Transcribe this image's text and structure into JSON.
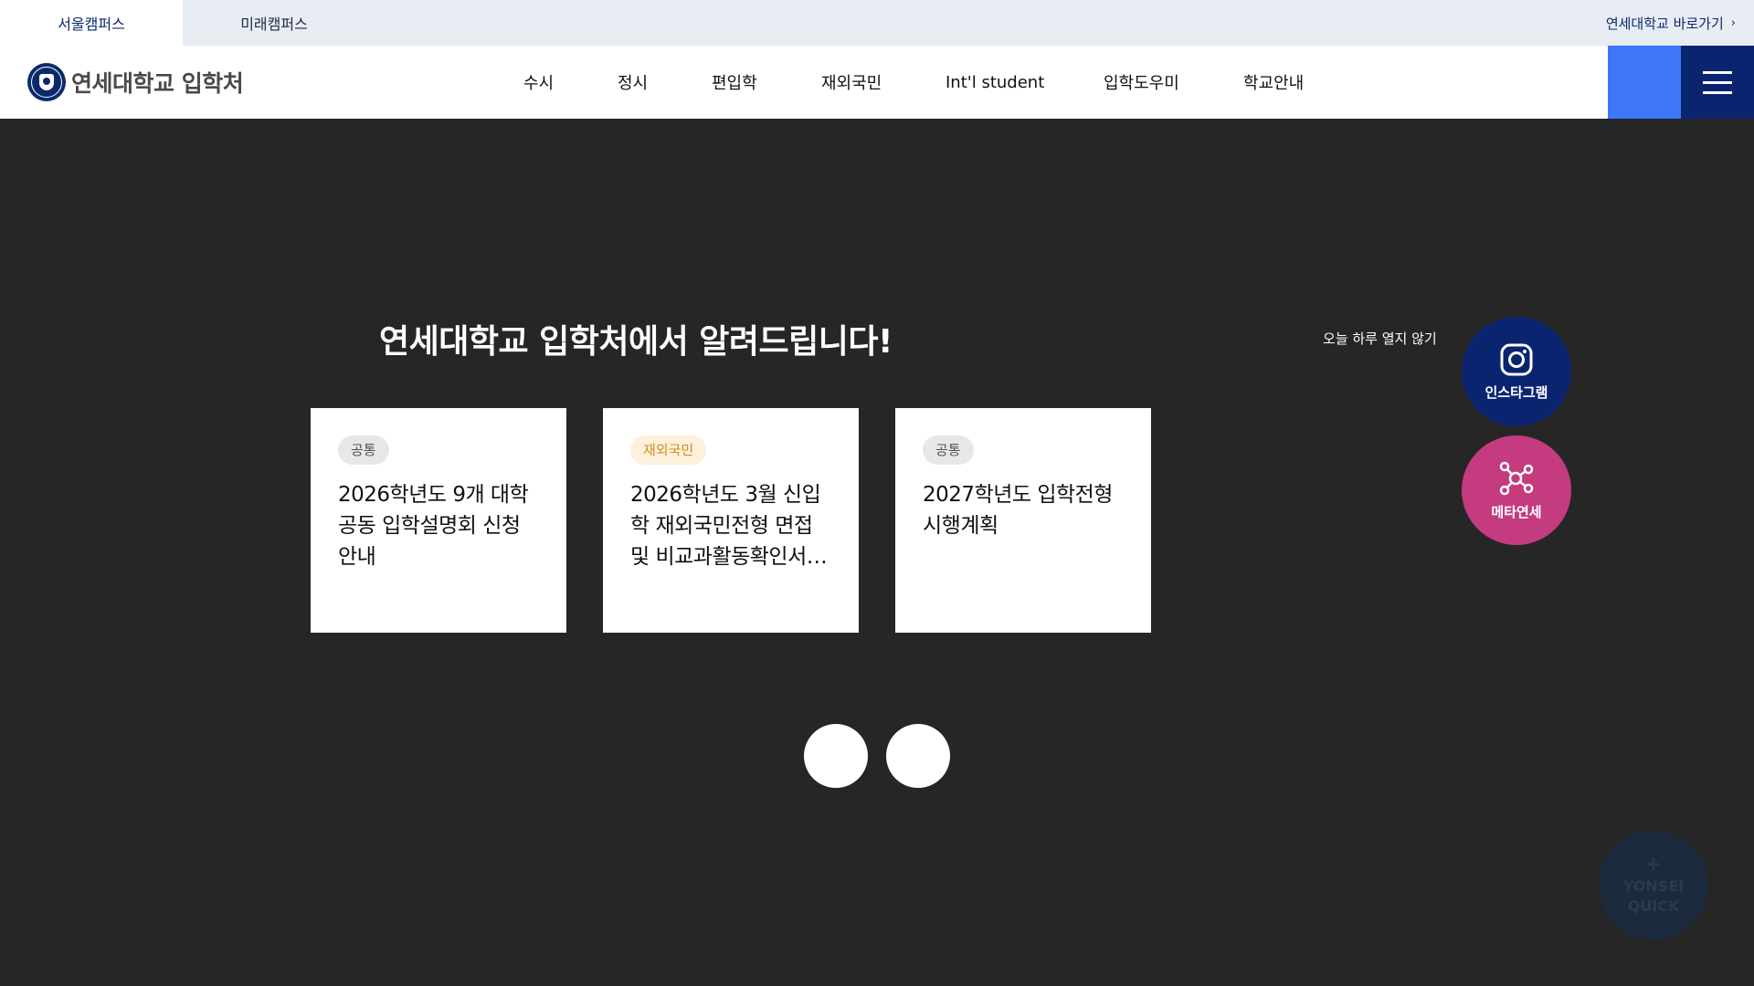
{
  "topbar": {
    "campus_tabs": [
      {
        "label": "서울캠퍼스",
        "active": true
      },
      {
        "label": "미래캠퍼스",
        "active": false
      }
    ],
    "goto_label": "연세대학교 바로가기"
  },
  "header": {
    "logo_text": "연세대학교 입학처",
    "nav": [
      "수시",
      "정시",
      "편입학",
      "재외국민",
      "Int'l student",
      "입학도우미",
      "학교안내"
    ]
  },
  "notice": {
    "title": "연세대학교 입학처에서 알려드립니다!",
    "close_today": "오늘 하루 열지 않기",
    "cards": [
      {
        "category": "공통",
        "text": "2026학년도 9개 대학 공동 입학설명회 신청 안내"
      },
      {
        "category": "재외국민",
        "text": "2026학년도 3월 신입학 재외국민전형 면접 및 비교과활동확인서…"
      },
      {
        "category": "공통",
        "text": "2027학년도 입학전형 시행계획"
      }
    ]
  },
  "floating": {
    "instagram_label": "인스타그램",
    "meta_label": "메타연세"
  },
  "quick": {
    "plus": "+",
    "line1": "YONSEI",
    "line2": "QUICK"
  },
  "colors": {
    "brand_navy": "#0b2470",
    "accent_blue": "#3d77f5",
    "meta_pink": "#c43b80",
    "overlay": "#262626"
  }
}
